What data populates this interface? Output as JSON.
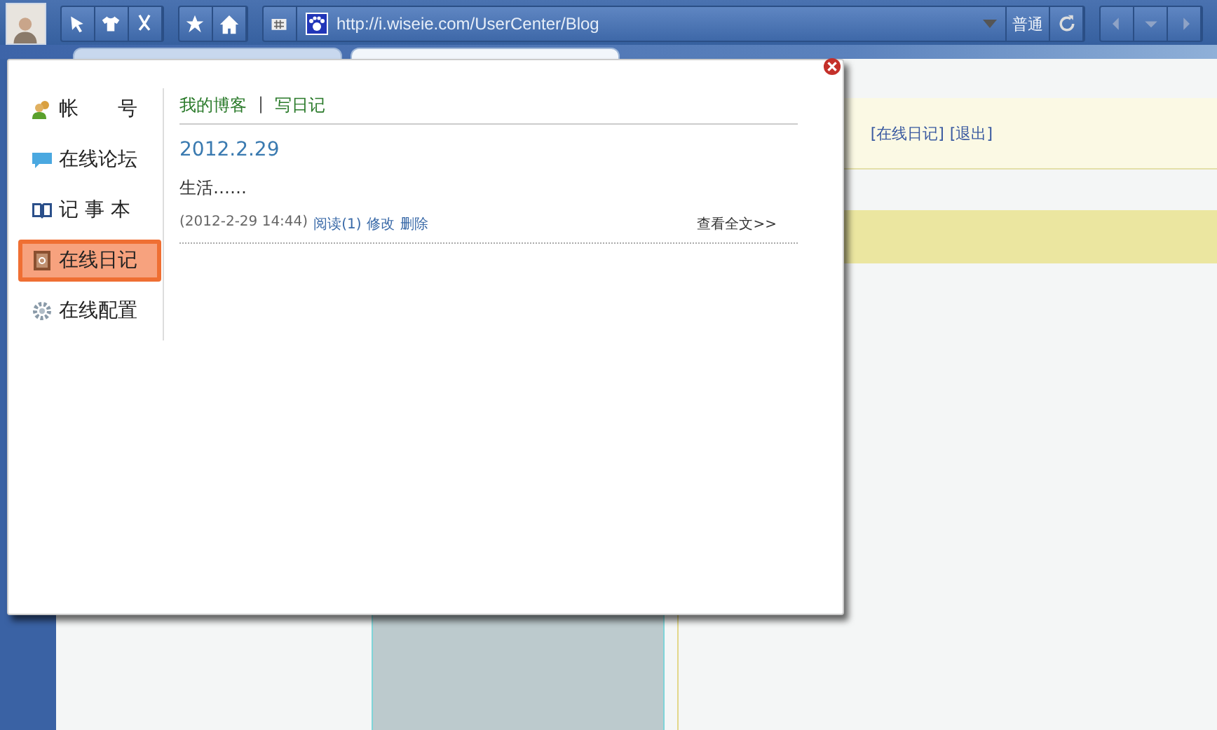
{
  "browser": {
    "url": "http://i.wiseie.com/UserCenter/Blog",
    "mode": "普通",
    "tabs": [
      {
        "selected": false
      },
      {
        "selected": true
      }
    ]
  },
  "background_page": {
    "links": [
      "[在线日记]",
      "[退出]"
    ]
  },
  "dialog": {
    "nav": [
      {
        "kind": "account",
        "label": "帐　　号",
        "selected": false
      },
      {
        "kind": "forum",
        "label": "在线论坛",
        "selected": false
      },
      {
        "kind": "notes",
        "label": "记 事 本",
        "selected": false
      },
      {
        "kind": "diary",
        "label": "在线日记",
        "selected": true
      },
      {
        "kind": "settings",
        "label": "在线配置",
        "selected": false
      }
    ],
    "top_links": [
      "我的博客",
      "写日记"
    ],
    "separator": "|",
    "posts": [
      {
        "title": "2012.2.29",
        "body": "生活……",
        "time": "(2012-2-29 14:44)",
        "actions": [
          "阅读(1)",
          "修改",
          "删除"
        ],
        "more": "查看全文>>"
      }
    ]
  }
}
